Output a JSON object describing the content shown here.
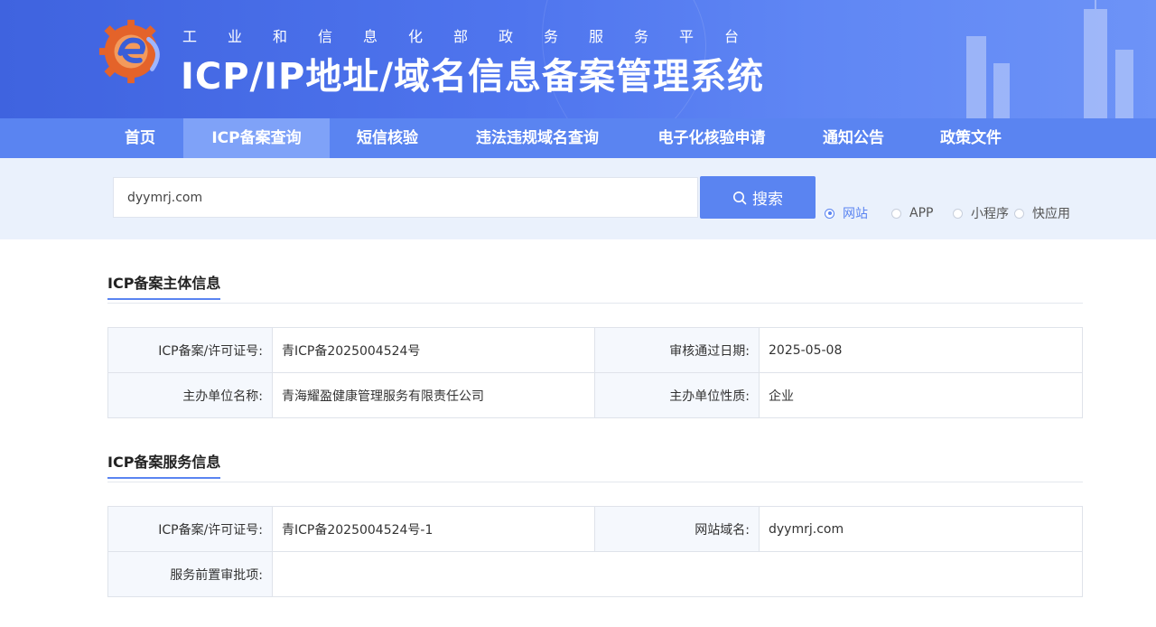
{
  "header": {
    "subtitle_chars": [
      "工",
      "业",
      "和",
      "信",
      "息",
      "化",
      "部",
      "政",
      "务",
      "服",
      "务",
      "平",
      "台"
    ],
    "title": "ICP/IP地址/域名信息备案管理系统"
  },
  "nav": {
    "items": [
      "首页",
      "ICP备案查询",
      "短信核验",
      "违法违规域名查询",
      "电子化核验申请",
      "通知公告",
      "政策文件"
    ],
    "active_index": 1
  },
  "search": {
    "value": "dyymrj.com",
    "button_label": "搜索",
    "types": [
      "网站",
      "APP",
      "小程序",
      "快应用"
    ],
    "selected_type": "网站"
  },
  "subject_section": {
    "title": "ICP备案主体信息",
    "rows": [
      {
        "k1": "ICP备案/许可证号:",
        "v1": "青ICP备2025004524号",
        "k2": "审核通过日期:",
        "v2": "2025-05-08"
      },
      {
        "k1": "主办单位名称:",
        "v1": "青海耀盈健康管理服务有限责任公司",
        "k2": "主办单位性质:",
        "v2": "企业"
      }
    ]
  },
  "service_section": {
    "title": "ICP备案服务信息",
    "rows": [
      {
        "k1": "ICP备案/许可证号:",
        "v1": "青ICP备2025004524号-1",
        "k2": "网站域名:",
        "v2": "dyymrj.com"
      },
      {
        "k1": "服务前置审批项:",
        "v1": ""
      }
    ]
  },
  "colors": {
    "primary": "#5a84f1",
    "banner": "#4f75ee",
    "search_band": "#eaf1fc"
  }
}
